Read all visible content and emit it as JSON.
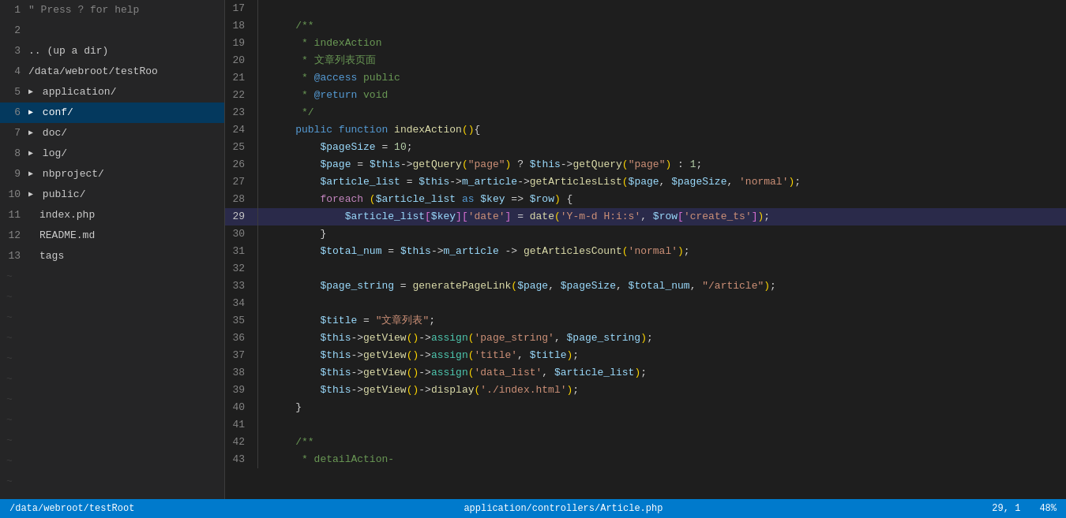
{
  "file_tree": {
    "items": [
      {
        "line": "1",
        "indent": 0,
        "icon": "",
        "label": "\" Press ? for help",
        "type": "header",
        "selected": false
      },
      {
        "line": "2",
        "indent": 0,
        "icon": "",
        "label": "",
        "type": "blank",
        "selected": false
      },
      {
        "line": "3",
        "indent": 0,
        "icon": "",
        "label": ".. (up a dir)",
        "type": "nav",
        "selected": false
      },
      {
        "line": "4",
        "indent": 0,
        "icon": "",
        "label": "/data/webroot/testRoo",
        "type": "nav",
        "selected": false
      },
      {
        "line": "5",
        "indent": 1,
        "icon": "▶",
        "label": "application/",
        "type": "folder",
        "selected": false
      },
      {
        "line": "6",
        "indent": 1,
        "icon": "▶",
        "label": "conf/",
        "type": "folder",
        "selected": true
      },
      {
        "line": "7",
        "indent": 1,
        "icon": "▶",
        "label": "doc/",
        "type": "folder",
        "selected": false
      },
      {
        "line": "8",
        "indent": 1,
        "icon": "▶",
        "label": "log/",
        "type": "folder",
        "selected": false
      },
      {
        "line": "9",
        "indent": 1,
        "icon": "▶",
        "label": "nbproject/",
        "type": "folder",
        "selected": false
      },
      {
        "line": "10",
        "indent": 1,
        "icon": "▶",
        "label": "public/",
        "type": "folder",
        "selected": false
      },
      {
        "line": "11",
        "indent": 0,
        "icon": "",
        "label": "index.php",
        "type": "file",
        "selected": false
      },
      {
        "line": "12",
        "indent": 0,
        "icon": "",
        "label": "README.md",
        "type": "file",
        "selected": false
      },
      {
        "line": "13",
        "indent": 0,
        "icon": "",
        "label": "tags",
        "type": "file",
        "selected": false
      }
    ]
  },
  "status_bar": {
    "left_path": "/data/webroot/testRoot",
    "center_path": "application/controllers/Article.php",
    "position": "29, 1",
    "zoom": "48%"
  }
}
